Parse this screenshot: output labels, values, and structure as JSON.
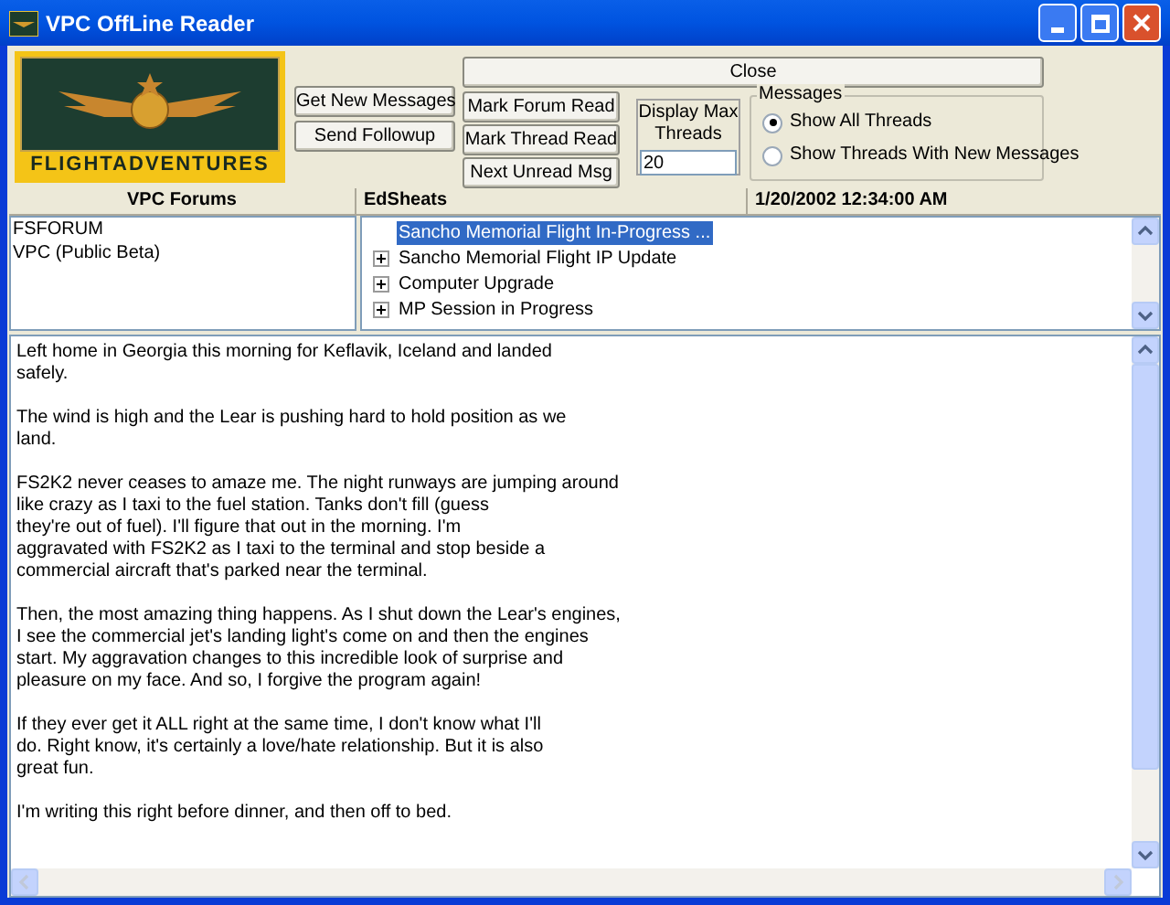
{
  "window": {
    "title": "VPC OffLine Reader"
  },
  "logo": {
    "text": "FLIGHTADVENTURES"
  },
  "buttons": {
    "get_new": "Get New Messages",
    "send_followup": "Send Followup",
    "mark_forum": "Mark Forum Read",
    "mark_thread": "Mark Thread Read",
    "next_unread": "Next Unread Msg",
    "close": "Close"
  },
  "display_max": {
    "label": "Display Max Threads",
    "value": "20"
  },
  "messages_group": {
    "title": "Messages",
    "options": [
      {
        "label": "Show All Threads",
        "selected": true
      },
      {
        "label": "Show Threads With New Messages",
        "selected": false
      }
    ]
  },
  "header": {
    "forums": "VPC Forums",
    "author": "EdSheats",
    "date": "1/20/2002 12:34:00 AM"
  },
  "forums": [
    {
      "label": "FSFORUM",
      "selected": false
    },
    {
      "label": "VPC (Public Beta)",
      "selected": false
    }
  ],
  "threads": [
    {
      "label": "Sancho Memorial Flight In-Progress ...",
      "selected": true,
      "expandable": false
    },
    {
      "label": "Sancho Memorial Flight IP Update",
      "selected": false,
      "expandable": true
    },
    {
      "label": "Computer Upgrade",
      "selected": false,
      "expandable": true
    },
    {
      "label": "MP Session in Progress",
      "selected": false,
      "expandable": true
    }
  ],
  "message": [
    [
      "Left home in Georgia this morning for Keflavik, Iceland and landed",
      "safely."
    ],
    [
      "The wind is high and the Lear is pushing hard to hold position as we",
      "land."
    ],
    [
      "FS2K2 never ceases to amaze me. The night runways are jumping around",
      "like crazy as I taxi to the fuel station. Tanks don't fill (guess",
      "they're out of fuel). I'll figure that out in the morning. I'm",
      "aggravated with FS2K2 as I taxi to the terminal and stop beside a",
      "commercial aircraft that's parked near the terminal."
    ],
    [
      "Then, the most amazing thing happens. As I shut down the Lear's engines,",
      "I see the commercial jet's landing light's come on and then the engines",
      "start. My aggravation changes to this incredible look of surprise and",
      "pleasure on my face. And so, I forgive the program again!"
    ],
    [
      "If they ever get it ALL right at the same time, I don't know what I'll",
      "do. Right know, it's certainly a love/hate relationship. But it is also",
      "great fun."
    ],
    [
      "I'm writing this right before dinner, and then off to bed."
    ]
  ]
}
